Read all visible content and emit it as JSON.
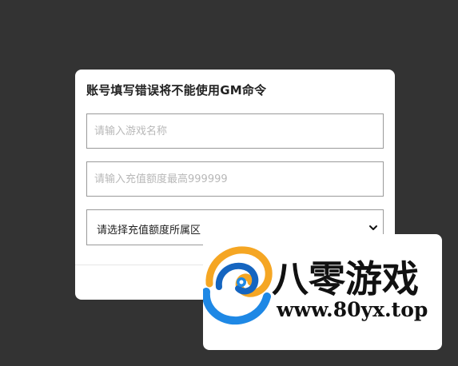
{
  "dialog": {
    "title": "账号填写错误将不能使用GM命令",
    "game_name_placeholder": "请输入游戏名称",
    "amount_placeholder": "请输入充值额度最高999999",
    "region_select_value": "请选择充值额度所属区"
  },
  "watermark": {
    "brand_name": "八零游戏",
    "url": "www.80yx.top"
  },
  "colors": {
    "background": "#333333",
    "logo_blue": "#1e88e5",
    "logo_orange": "#f5a623"
  },
  "icons": {
    "select_arrow": "chevron-down-icon",
    "logo": "swirl-logo-icon"
  }
}
